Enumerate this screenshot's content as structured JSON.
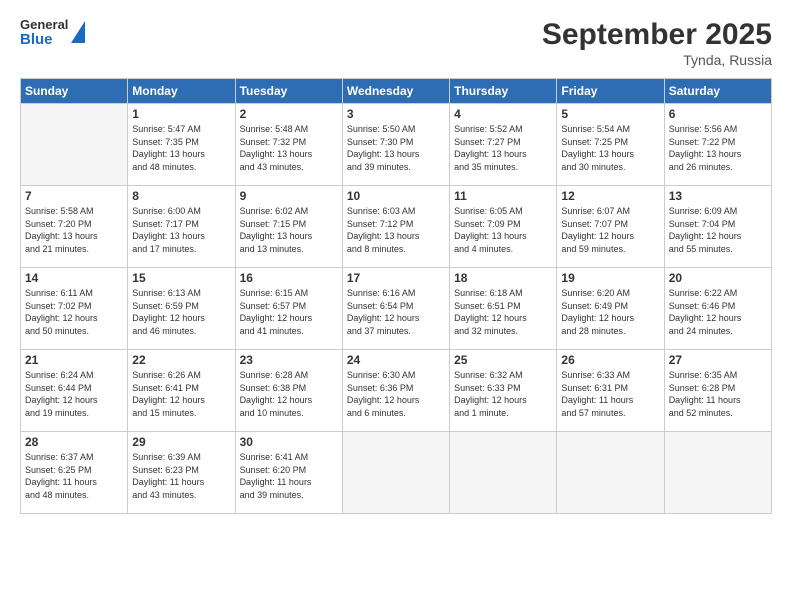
{
  "logo": {
    "general": "General",
    "blue": "Blue"
  },
  "title": "September 2025",
  "location": "Tynda, Russia",
  "headers": [
    "Sunday",
    "Monday",
    "Tuesday",
    "Wednesday",
    "Thursday",
    "Friday",
    "Saturday"
  ],
  "weeks": [
    [
      {
        "day": "",
        "info": ""
      },
      {
        "day": "1",
        "info": "Sunrise: 5:47 AM\nSunset: 7:35 PM\nDaylight: 13 hours\nand 48 minutes."
      },
      {
        "day": "2",
        "info": "Sunrise: 5:48 AM\nSunset: 7:32 PM\nDaylight: 13 hours\nand 43 minutes."
      },
      {
        "day": "3",
        "info": "Sunrise: 5:50 AM\nSunset: 7:30 PM\nDaylight: 13 hours\nand 39 minutes."
      },
      {
        "day": "4",
        "info": "Sunrise: 5:52 AM\nSunset: 7:27 PM\nDaylight: 13 hours\nand 35 minutes."
      },
      {
        "day": "5",
        "info": "Sunrise: 5:54 AM\nSunset: 7:25 PM\nDaylight: 13 hours\nand 30 minutes."
      },
      {
        "day": "6",
        "info": "Sunrise: 5:56 AM\nSunset: 7:22 PM\nDaylight: 13 hours\nand 26 minutes."
      }
    ],
    [
      {
        "day": "7",
        "info": "Sunrise: 5:58 AM\nSunset: 7:20 PM\nDaylight: 13 hours\nand 21 minutes."
      },
      {
        "day": "8",
        "info": "Sunrise: 6:00 AM\nSunset: 7:17 PM\nDaylight: 13 hours\nand 17 minutes."
      },
      {
        "day": "9",
        "info": "Sunrise: 6:02 AM\nSunset: 7:15 PM\nDaylight: 13 hours\nand 13 minutes."
      },
      {
        "day": "10",
        "info": "Sunrise: 6:03 AM\nSunset: 7:12 PM\nDaylight: 13 hours\nand 8 minutes."
      },
      {
        "day": "11",
        "info": "Sunrise: 6:05 AM\nSunset: 7:09 PM\nDaylight: 13 hours\nand 4 minutes."
      },
      {
        "day": "12",
        "info": "Sunrise: 6:07 AM\nSunset: 7:07 PM\nDaylight: 12 hours\nand 59 minutes."
      },
      {
        "day": "13",
        "info": "Sunrise: 6:09 AM\nSunset: 7:04 PM\nDaylight: 12 hours\nand 55 minutes."
      }
    ],
    [
      {
        "day": "14",
        "info": "Sunrise: 6:11 AM\nSunset: 7:02 PM\nDaylight: 12 hours\nand 50 minutes."
      },
      {
        "day": "15",
        "info": "Sunrise: 6:13 AM\nSunset: 6:59 PM\nDaylight: 12 hours\nand 46 minutes."
      },
      {
        "day": "16",
        "info": "Sunrise: 6:15 AM\nSunset: 6:57 PM\nDaylight: 12 hours\nand 41 minutes."
      },
      {
        "day": "17",
        "info": "Sunrise: 6:16 AM\nSunset: 6:54 PM\nDaylight: 12 hours\nand 37 minutes."
      },
      {
        "day": "18",
        "info": "Sunrise: 6:18 AM\nSunset: 6:51 PM\nDaylight: 12 hours\nand 32 minutes."
      },
      {
        "day": "19",
        "info": "Sunrise: 6:20 AM\nSunset: 6:49 PM\nDaylight: 12 hours\nand 28 minutes."
      },
      {
        "day": "20",
        "info": "Sunrise: 6:22 AM\nSunset: 6:46 PM\nDaylight: 12 hours\nand 24 minutes."
      }
    ],
    [
      {
        "day": "21",
        "info": "Sunrise: 6:24 AM\nSunset: 6:44 PM\nDaylight: 12 hours\nand 19 minutes."
      },
      {
        "day": "22",
        "info": "Sunrise: 6:26 AM\nSunset: 6:41 PM\nDaylight: 12 hours\nand 15 minutes."
      },
      {
        "day": "23",
        "info": "Sunrise: 6:28 AM\nSunset: 6:38 PM\nDaylight: 12 hours\nand 10 minutes."
      },
      {
        "day": "24",
        "info": "Sunrise: 6:30 AM\nSunset: 6:36 PM\nDaylight: 12 hours\nand 6 minutes."
      },
      {
        "day": "25",
        "info": "Sunrise: 6:32 AM\nSunset: 6:33 PM\nDaylight: 12 hours\nand 1 minute."
      },
      {
        "day": "26",
        "info": "Sunrise: 6:33 AM\nSunset: 6:31 PM\nDaylight: 11 hours\nand 57 minutes."
      },
      {
        "day": "27",
        "info": "Sunrise: 6:35 AM\nSunset: 6:28 PM\nDaylight: 11 hours\nand 52 minutes."
      }
    ],
    [
      {
        "day": "28",
        "info": "Sunrise: 6:37 AM\nSunset: 6:25 PM\nDaylight: 11 hours\nand 48 minutes."
      },
      {
        "day": "29",
        "info": "Sunrise: 6:39 AM\nSunset: 6:23 PM\nDaylight: 11 hours\nand 43 minutes."
      },
      {
        "day": "30",
        "info": "Sunrise: 6:41 AM\nSunset: 6:20 PM\nDaylight: 11 hours\nand 39 minutes."
      },
      {
        "day": "",
        "info": ""
      },
      {
        "day": "",
        "info": ""
      },
      {
        "day": "",
        "info": ""
      },
      {
        "day": "",
        "info": ""
      }
    ]
  ]
}
